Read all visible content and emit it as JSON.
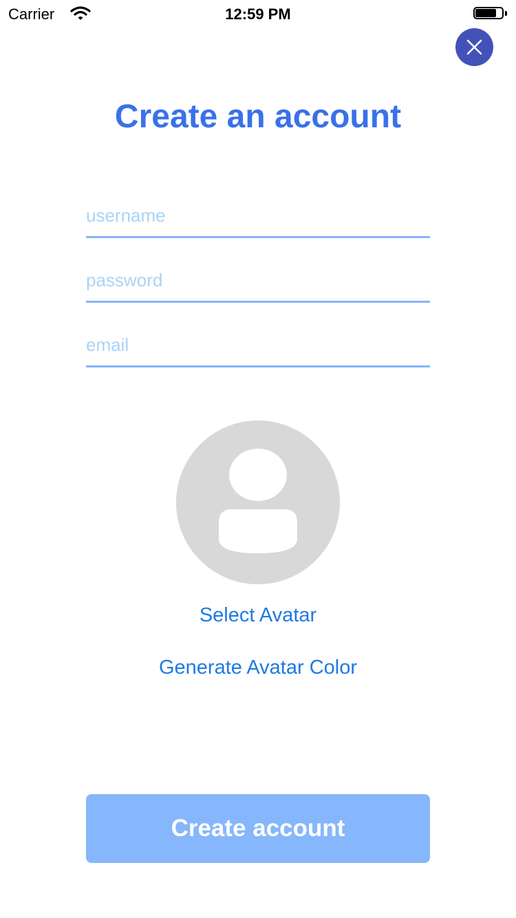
{
  "status_bar": {
    "carrier": "Carrier",
    "time": "12:59 PM",
    "wifi_icon": "wifi-icon",
    "battery_icon": "battery-icon"
  },
  "close": {
    "icon": "close-icon",
    "color": "#4352b8"
  },
  "title": "Create an account",
  "form": {
    "username_placeholder": "username",
    "username_value": "",
    "password_placeholder": "password",
    "password_value": "",
    "email_placeholder": "email",
    "email_value": ""
  },
  "avatar": {
    "icon": "person-icon"
  },
  "select_avatar_label": "Select Avatar",
  "generate_color_label": "Generate Avatar Color",
  "create_button_label": "Create account",
  "colors": {
    "title": "#3a71ea",
    "field_underline": "#84b4fb",
    "placeholder": "#a8d4f7",
    "link": "#1f7ae0",
    "primary_button": "#86b6fb",
    "avatar_bg": "#d8d8d8"
  }
}
